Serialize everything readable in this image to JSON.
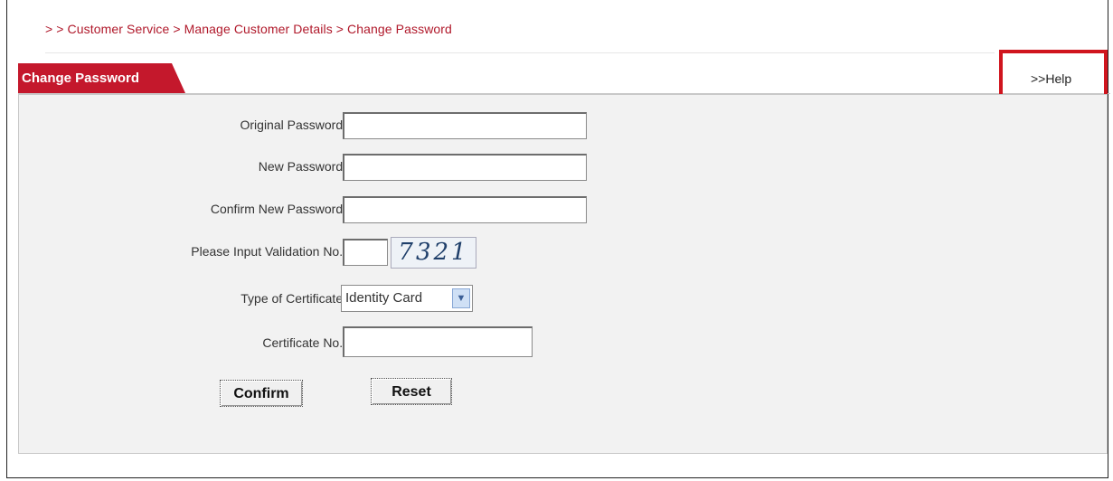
{
  "breadcrumb": "> > Customer Service > Manage Customer Details > Change Password",
  "tab": {
    "title": "Change Password"
  },
  "help": {
    "label": ">>Help"
  },
  "form": {
    "original_password_label": "Original Password:",
    "original_password_value": "",
    "new_password_label": "New Password:",
    "new_password_value": "",
    "confirm_password_label": "Confirm New Password:",
    "confirm_password_value": "",
    "validation_label": "Please Input Validation No.:",
    "validation_value": "",
    "captcha_text": "7321",
    "certificate_type_label": "Type of Certificate:",
    "certificate_type_selected": "Identity Card",
    "certificate_no_label": "Certificate No.:",
    "certificate_no_value": ""
  },
  "buttons": {
    "confirm": "Confirm",
    "reset": "Reset"
  },
  "colors": {
    "brand_red": "#c4182c",
    "highlight_red": "#d0151e"
  }
}
